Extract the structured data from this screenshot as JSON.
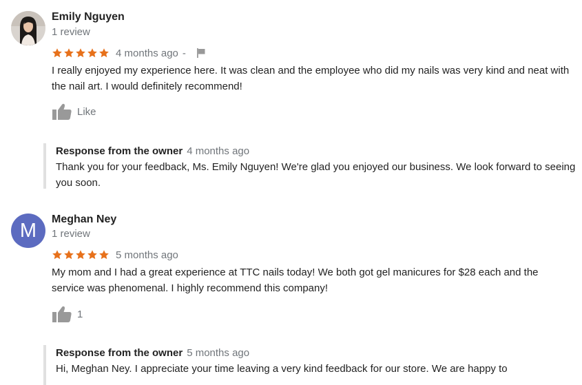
{
  "colors": {
    "star": "#e7711b",
    "meta_gray": "#70757a",
    "icon_gray": "#999999",
    "avatar_purple": "#5c6bc0",
    "response_border": "#e0e0e0"
  },
  "reviews": [
    {
      "name": "Emily Nguyen",
      "review_count": "1 review",
      "rating": 5,
      "time": "4 months ago",
      "separator": "-",
      "avatar": {
        "type": "photo",
        "icon": "user-photo"
      },
      "text": "I really enjoyed my experience here. It was clean and the employee who did my nails was very kind and neat with the nail art. I would definitely recommend!",
      "like_label": "Like",
      "owner_response": {
        "title": "Response from the owner",
        "time": "4 months ago",
        "text": "Thank you for your feedback, Ms. Emily Nguyen! We're glad you enjoyed our business. We look forward to seeing you soon."
      }
    },
    {
      "name": "Meghan Ney",
      "review_count": "1 review",
      "rating": 5,
      "time": "5 months ago",
      "avatar": {
        "type": "letter",
        "letter": "M"
      },
      "text": "My mom and I had a great experience at TTC nails today! We both got gel manicures for $28 each and the service was phenomenal. I highly recommend this company!",
      "like_label": "1",
      "owner_response": {
        "title": "Response from the owner",
        "time": "5 months ago",
        "text": "Hi, Meghan Ney. I appreciate your time leaving a very kind feedback for our store. We are happy to"
      }
    }
  ]
}
